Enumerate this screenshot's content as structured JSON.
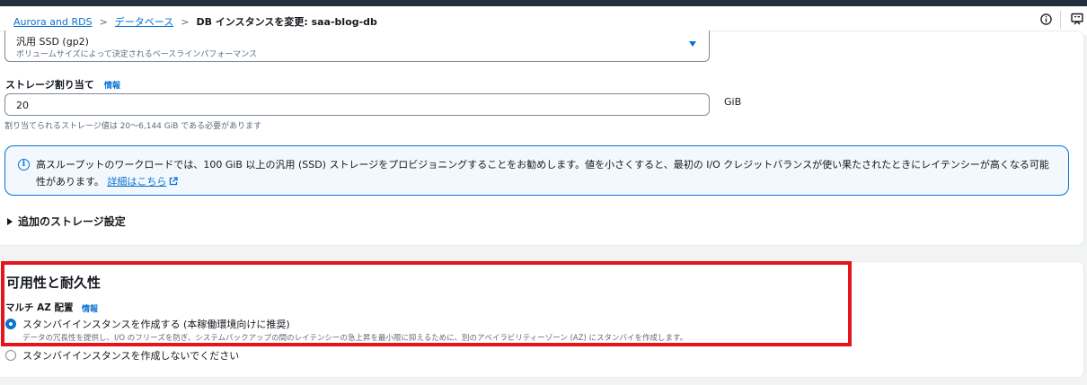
{
  "breadcrumb": {
    "items": [
      "Aurora and RDS",
      "データベース",
      "DB インスタンスを変更: saa-blog-db"
    ]
  },
  "storage_type": {
    "value": "汎用 SSD (gp2)",
    "description": "ボリュームサイズによって決定されるベースラインパフォーマンス"
  },
  "storage_allocation": {
    "label": "ストレージ割り当て",
    "info": "情報",
    "value": "20",
    "unit": "GiB",
    "hint": "割り当てられるストレージ値は 20〜6,144 GiB である必要があります"
  },
  "alert": {
    "text": "高スループットのワークロードでは、100 GiB 以上の汎用 (SSD) ストレージをプロビジョニングすることをお勧めします。値を小さくすると、最初の I/O クレジットバランスが使い果たされたときにレイテンシーが高くなる可能性があります。",
    "link": "詳細はこちら"
  },
  "additional_storage": {
    "label": "追加のストレージ設定"
  },
  "availability": {
    "title": "可用性と耐久性",
    "multi_az_label": "マルチ AZ 配置",
    "info": "情報",
    "options": [
      {
        "label": "スタンバイインスタンスを作成する (本稼働環境向けに推奨)",
        "description": "データの冗長性を提供し、I/O のフリーズを防ぎ、システムバックアップの間のレイテンシーの急上昇を最小限に抑えるために、別のアベイラビリティーゾーン (AZ) にスタンバイを作成します。",
        "selected": true
      },
      {
        "label": "スタンバイインスタンスを作成しないでください",
        "selected": false
      }
    ]
  },
  "colors": {
    "link": "#0972d3",
    "highlight": "#e5161b",
    "alert_bg": "#f2f8fd"
  },
  "icons": [
    "info-circle-icon",
    "feedback-icon",
    "external-link-icon",
    "caret-down-icon",
    "caret-right-icon"
  ]
}
